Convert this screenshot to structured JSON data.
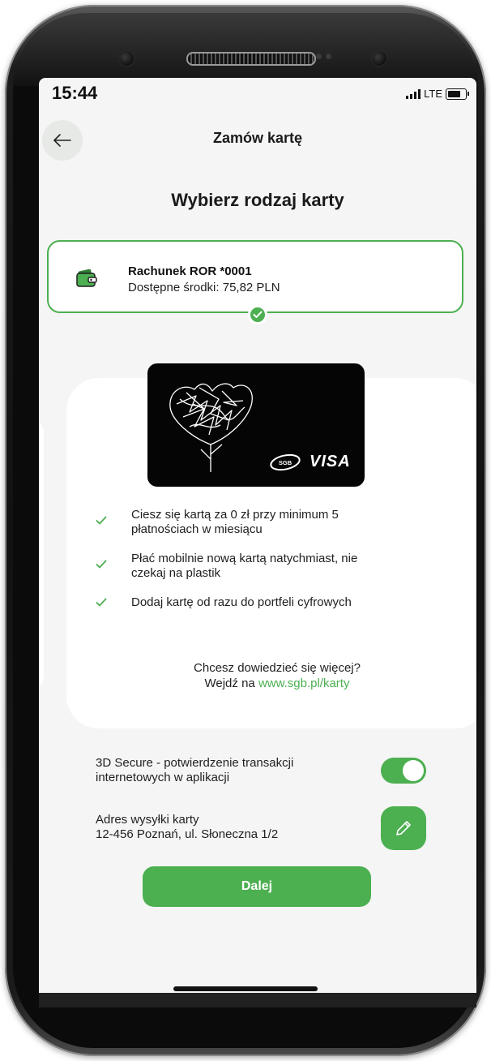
{
  "status_bar": {
    "time": "15:44",
    "network": "LTE"
  },
  "header": {
    "title": "Zamów kartę",
    "back_icon": "arrow-left-icon"
  },
  "page_title": "Wybierz rodzaj karty",
  "account": {
    "name": "Rachunek ROR *0001",
    "funds": "Dostępne środki: 75,82 PLN",
    "icon": "wallet-icon",
    "selected": true
  },
  "card": {
    "bank_logo": "SGB",
    "brand": "VISA"
  },
  "benefits": [
    {
      "line1": "Ciesz się kartą za 0 zł przy minimum 5",
      "line2": "płatnościach w miesiącu"
    },
    {
      "line1": "Płać mobilnie nową kartą natychmiast, nie",
      "line2": "czekaj na plastik"
    },
    {
      "line1": "Dodaj kartę od razu do portfeli cyfrowych",
      "line2": ""
    }
  ],
  "more_info": {
    "question": "Chcesz dowiedzieć się więcej?",
    "prefix": "Wejdź na",
    "link": "www.sgb.pl/karty"
  },
  "secure3d": {
    "line1": "3D Secure - potwierdzenie transakcji",
    "line2": "internetowych w aplikacji",
    "enabled": true
  },
  "address": {
    "label": "Adres wysyłki karty",
    "value": "12-456 Poznań, ul. Słoneczna 1/2",
    "edit_icon": "pencil-icon"
  },
  "next_button": "Dalej",
  "colors": {
    "accent": "#4caf50",
    "background": "#f4f5f4"
  }
}
